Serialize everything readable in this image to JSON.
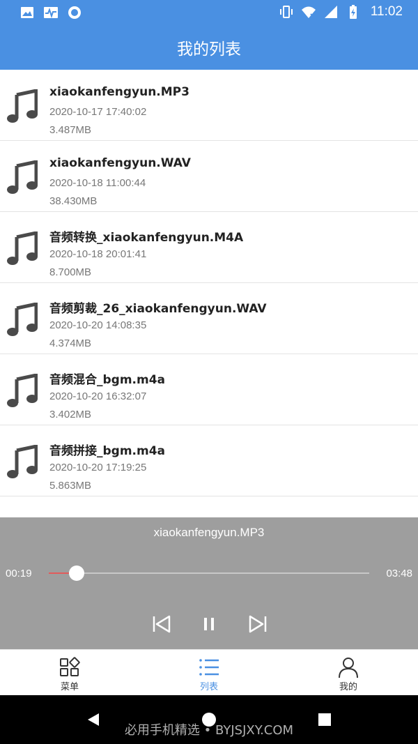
{
  "status_bar": {
    "time": "11:02"
  },
  "app_bar": {
    "title": "我的列表"
  },
  "files": [
    {
      "name": "xiaokanfengyun.MP3",
      "date": "2020-10-17 17:40:02",
      "size": "3.487MB"
    },
    {
      "name": "xiaokanfengyun.WAV",
      "date": "2020-10-18 11:00:44",
      "size": "38.430MB"
    },
    {
      "name": "音频转换_xiaokanfengyun.M4A",
      "date": "2020-10-18 20:01:41",
      "size": "8.700MB"
    },
    {
      "name": "音频剪裁_26_xiaokanfengyun.WAV",
      "date": "2020-10-20 14:08:35",
      "size": "4.374MB"
    },
    {
      "name": "音频混合_bgm.m4a",
      "date": "2020-10-20 16:32:07",
      "size": "3.402MB"
    },
    {
      "name": "音频拼接_bgm.m4a",
      "date": "2020-10-20 17:19:25",
      "size": "5.863MB"
    }
  ],
  "player": {
    "title": "xiaokanfengyun.MP3",
    "current_time": "00:19",
    "total_time": "03:48",
    "progress": 0.087
  },
  "bottom_nav": {
    "items": [
      {
        "label": "菜单",
        "icon": "grid-icon",
        "active": false
      },
      {
        "label": "列表",
        "icon": "list-icon",
        "active": true
      },
      {
        "label": "我的",
        "icon": "person-icon",
        "active": false
      }
    ]
  },
  "watermark": "必用手机精选 • BYJSJXY.COM",
  "colors": {
    "primary": "#4a90e2",
    "player_bg": "#9e9e9e",
    "progress": "#e25b5b"
  }
}
